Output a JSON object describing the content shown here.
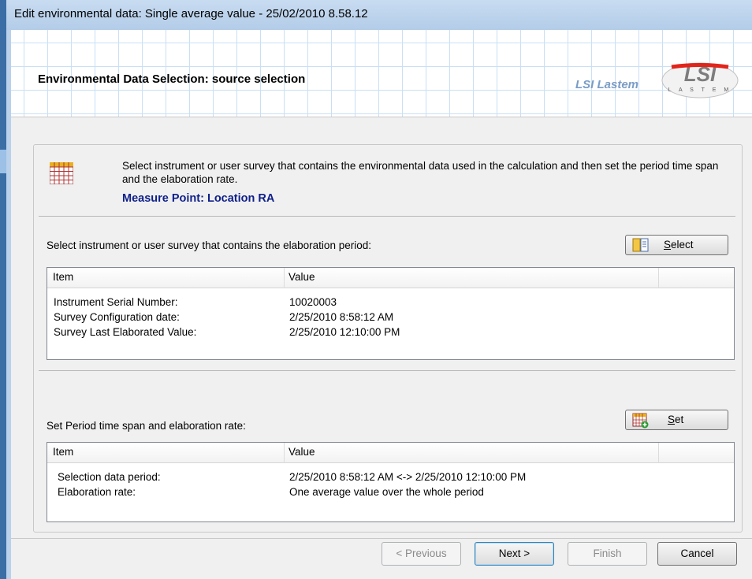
{
  "window": {
    "title": "Edit environmental data: Single average value - 25/02/2010 8.58.12"
  },
  "header": {
    "title": "Environmental Data Selection: source selection",
    "brand_name": "LSI Lastem",
    "logo_text": "LSI LASTEM"
  },
  "intro": {
    "icon": "calendar-grid-icon",
    "description": "Select instrument or user survey that contains the environmental data used in the calculation and then set the period time span and the elaboration rate.",
    "measure_point": "Measure Point: Location RA"
  },
  "source_section": {
    "label": "Select instrument or user  survey that contains the elaboration period:",
    "button_label": "Select",
    "button_icon": "book-icon",
    "columns": [
      "Item",
      "Value"
    ],
    "rows": [
      {
        "item": "Instrument Serial Number:",
        "value": "10020003"
      },
      {
        "item": "Survey Configuration date:",
        "value": "2/25/2010 8:58:12 AM"
      },
      {
        "item": "Survey Last Elaborated Value:",
        "value": "2/25/2010 12:10:00 PM"
      }
    ]
  },
  "period_section": {
    "label": "Set Period time span and elaboration rate:",
    "button_label": "Set",
    "button_icon": "calendar-add-icon",
    "columns": [
      "Item",
      "Value"
    ],
    "rows": [
      {
        "item": "Selection data period:",
        "value": "2/25/2010 8:58:12 AM <-> 2/25/2010 12:10:00 PM"
      },
      {
        "item": "Elaboration rate:",
        "value": "One average value over the whole period"
      }
    ]
  },
  "footer": {
    "previous_label": "< Previous",
    "next_label": "Next >",
    "finish_label": "Finish",
    "cancel_label": "Cancel"
  },
  "colors": {
    "title_bar": "#b9d1ea",
    "measure_point_text": "#0e1f8a",
    "brand_text": "#7a9cc6",
    "logo_red": "#e1251b"
  }
}
